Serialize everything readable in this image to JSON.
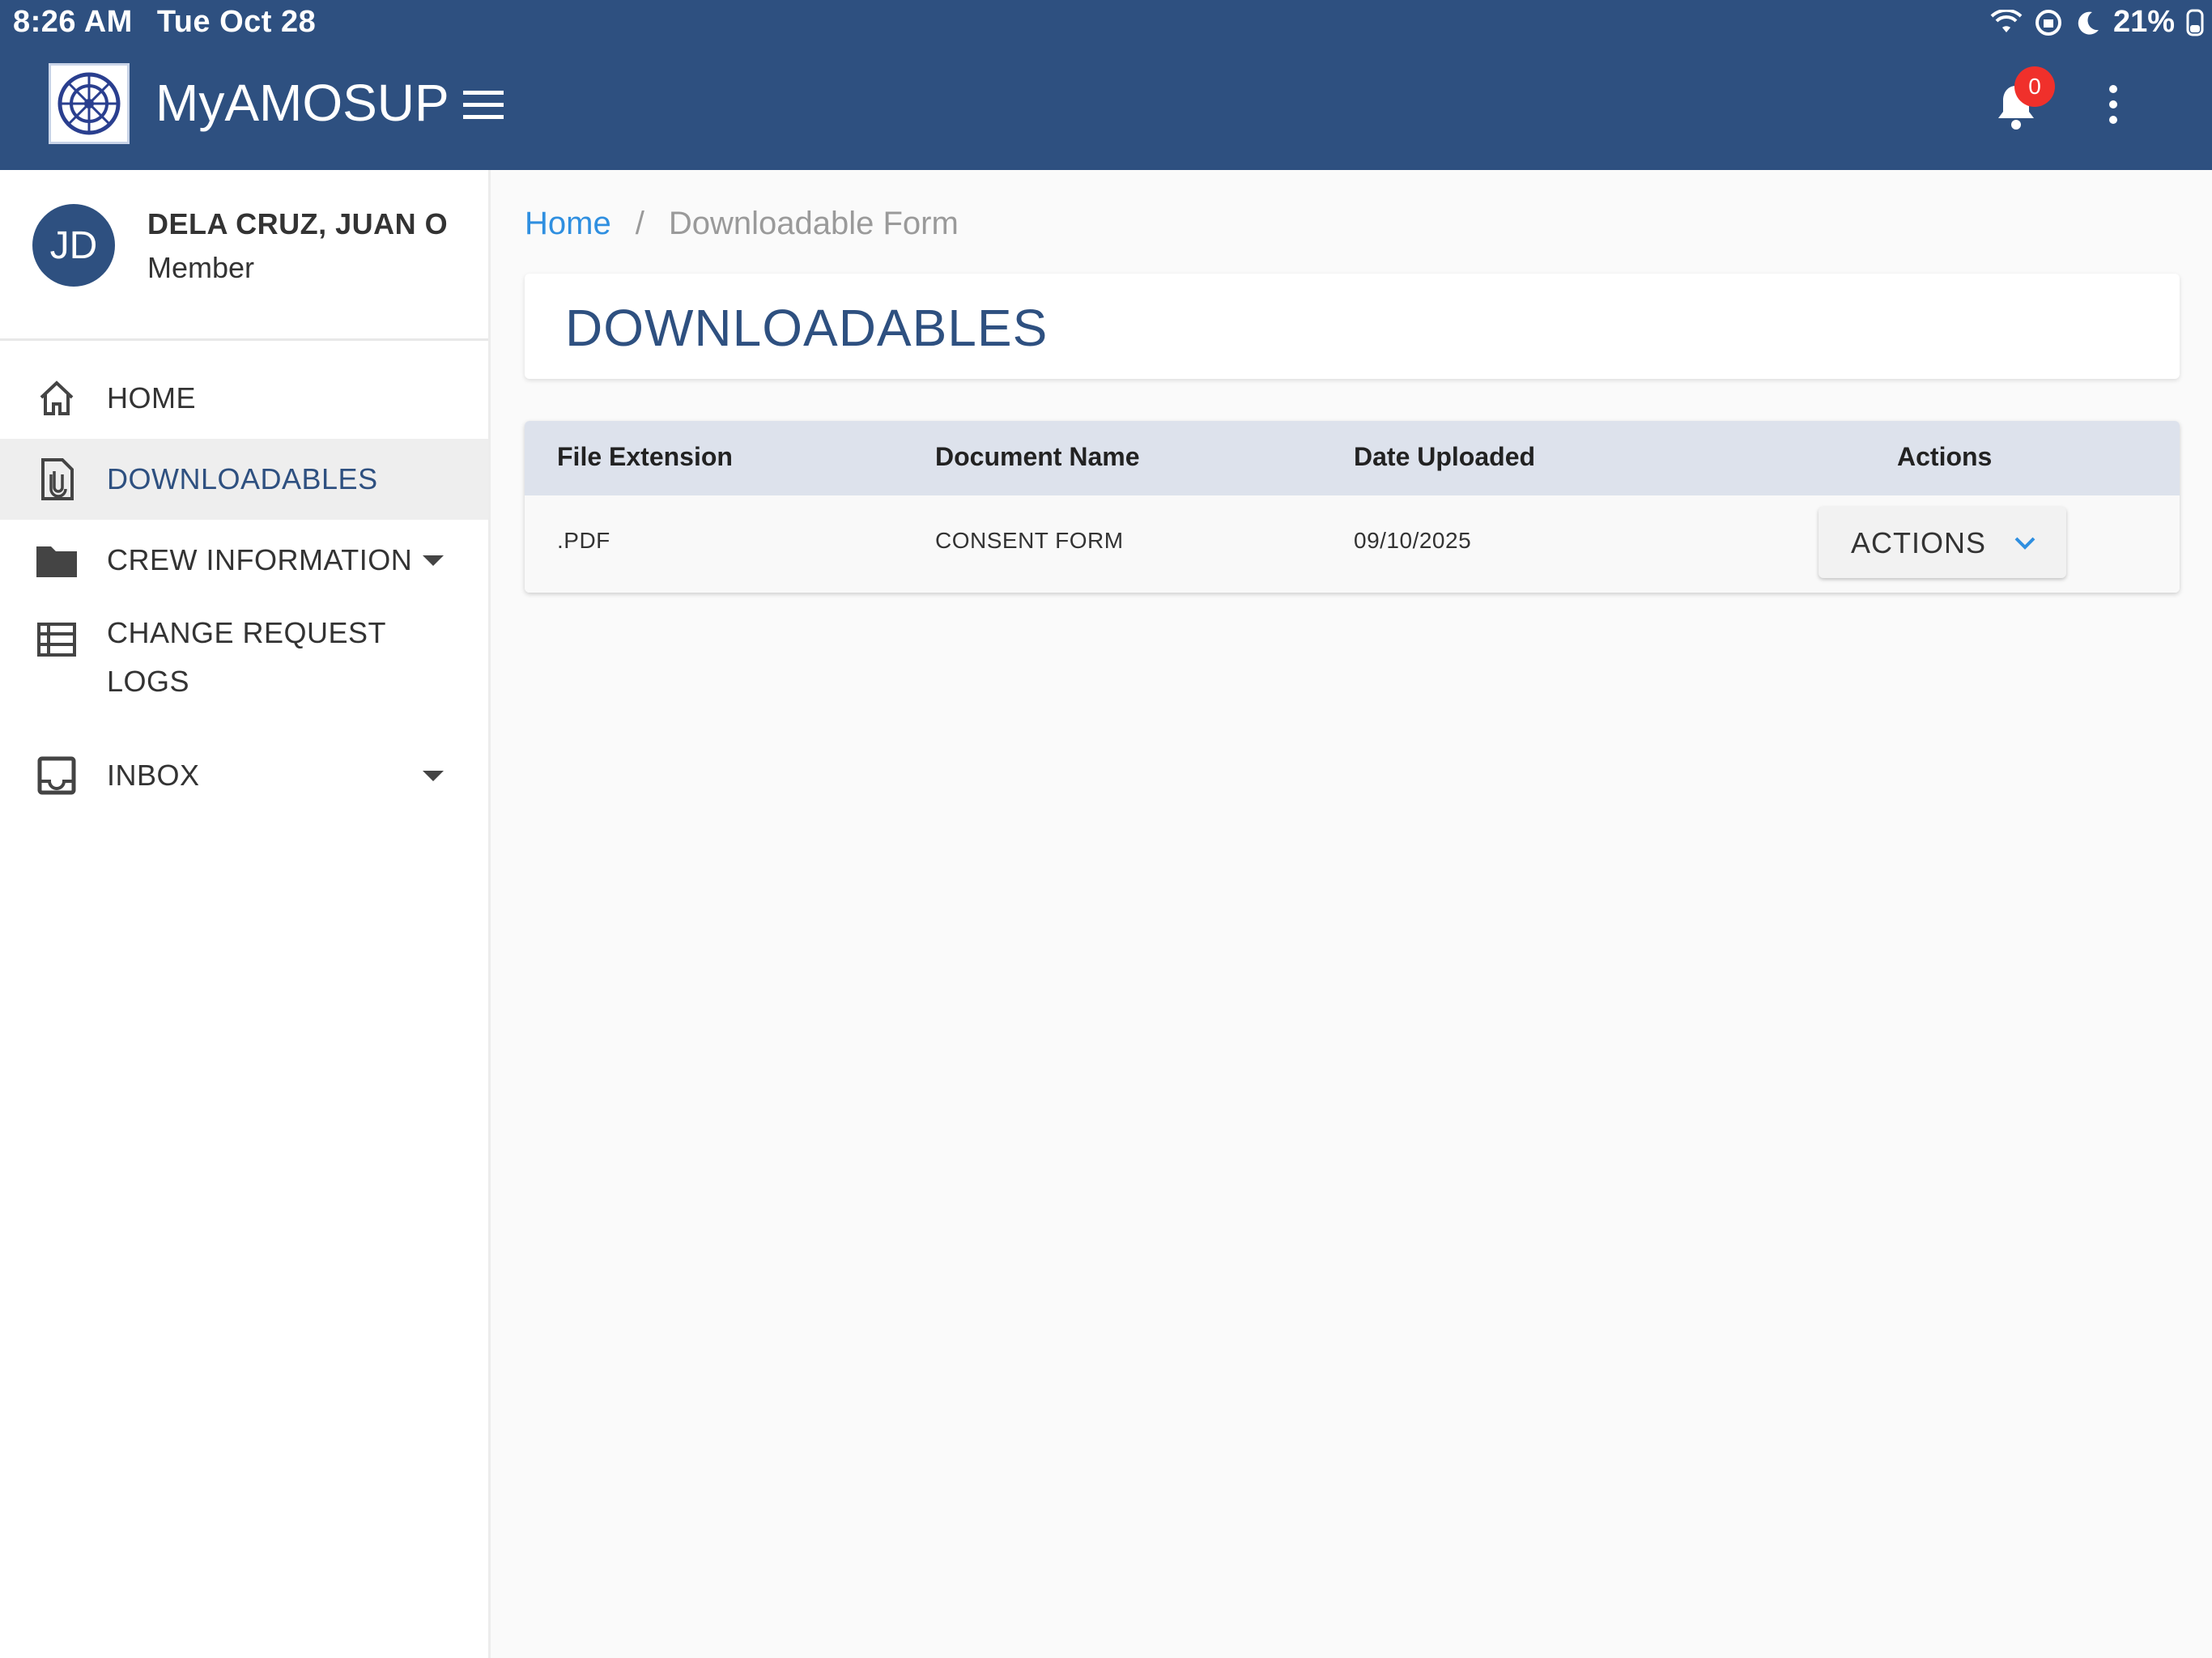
{
  "status_bar": {
    "time": "8:26 AM",
    "date": "Tue Oct 28",
    "battery": "21%"
  },
  "header": {
    "title": "MyAMOSUP",
    "notification_count": "0"
  },
  "user": {
    "initials": "JD",
    "name": "DELA CRUZ, JUAN O",
    "role": "Member"
  },
  "sidebar": {
    "items": [
      {
        "label": "HOME",
        "icon": "home-icon"
      },
      {
        "label": "DOWNLOADABLES",
        "icon": "document-icon",
        "active": true
      },
      {
        "label": "CREW INFORMATION",
        "icon": "folder-icon",
        "expandable": true
      },
      {
        "label_line1": "CHANGE REQUEST",
        "label_line2": "LOGS",
        "icon": "list-icon"
      },
      {
        "label": "INBOX",
        "icon": "inbox-icon",
        "expandable": true
      }
    ]
  },
  "breadcrumb": {
    "home": "Home",
    "separator": "/",
    "current": "Downloadable Form"
  },
  "page": {
    "title": "DOWNLOADABLES"
  },
  "table": {
    "headers": [
      "File Extension",
      "Document Name",
      "Date Uploaded",
      "Actions"
    ],
    "rows": [
      {
        "extension": ".PDF",
        "name": "CONSENT FORM",
        "date": "09/10/2025",
        "action_label": "ACTIONS"
      }
    ]
  },
  "colors": {
    "brand": "#2e5080",
    "link": "#2f8fe0",
    "badge": "#f0302b"
  }
}
